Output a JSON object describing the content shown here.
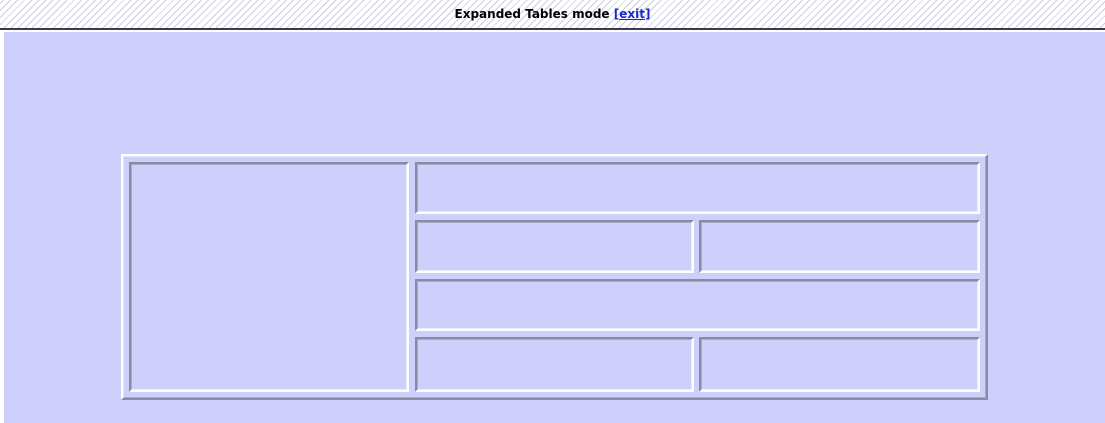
{
  "banner": {
    "mode_label": "Expanded Tables mode",
    "exit_open_bracket": "[",
    "exit_link": "exit",
    "exit_close_bracket": "]"
  },
  "colors": {
    "canvas_background": "#cfcffb",
    "link": "#1a27d6",
    "bevel_light": "#ffffff",
    "bevel_dark": "#8a8aa6"
  }
}
